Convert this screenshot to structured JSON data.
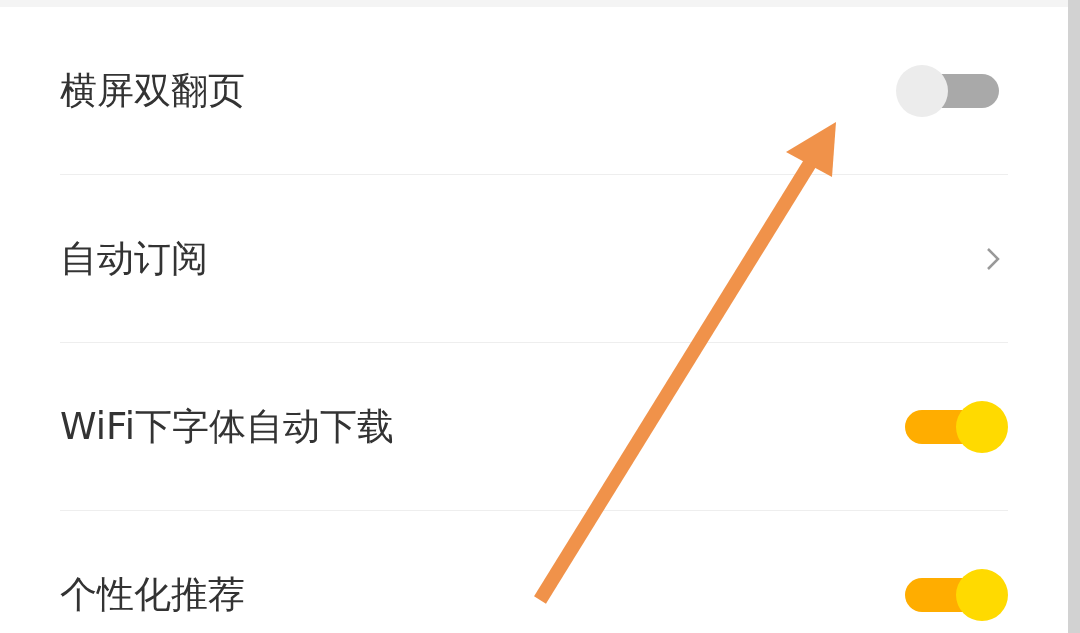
{
  "settings": [
    {
      "kind": "toggle",
      "label": "横屏双翻页",
      "on": false
    },
    {
      "kind": "link",
      "label": "自动订阅"
    },
    {
      "kind": "toggle",
      "label": "WiFi下字体自动下载",
      "on": true
    },
    {
      "kind": "toggle",
      "label": "个性化推荐",
      "on": true
    }
  ]
}
